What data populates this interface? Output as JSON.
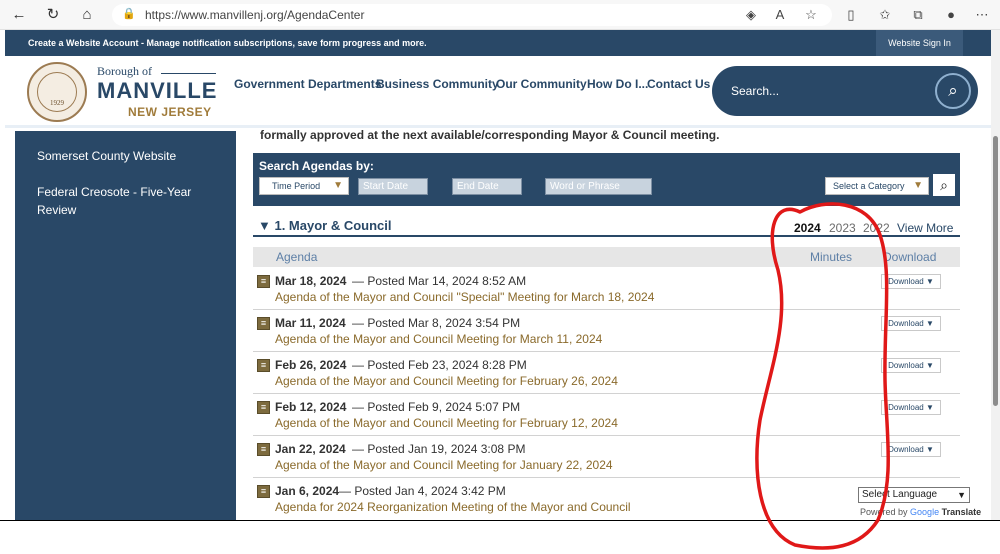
{
  "browser": {
    "url": "https://www.manvillenj.org/AgendaCenter"
  },
  "notice": {
    "text": "Create a Website Account - Manage notification subscriptions, save form progress and more.",
    "signin": "Website Sign In"
  },
  "brand": {
    "borough": "Borough of",
    "town": "MANVILLE",
    "state": "NEW JERSEY",
    "seal_year": "1929"
  },
  "nav": [
    "Government Departments",
    "Business Community",
    "Our Community",
    "How Do I...",
    "Contact Us"
  ],
  "site_search": {
    "placeholder": "Search..."
  },
  "sidebar": {
    "items": [
      "Somerset County Website",
      "Federal Creosote - Five-Year Review"
    ]
  },
  "intro_text": "formally approved at the next available/corresponding Mayor & Council meeting.",
  "search_agendas": {
    "title": "Search Agendas by:",
    "time_period": "Time Period",
    "start_date": "Start Date",
    "end_date": "End Date",
    "word": "Word or Phrase",
    "category": "Select a Category"
  },
  "category": {
    "title": "▼ 1. Mayor & Council",
    "years": [
      "2024",
      "2023",
      "2022"
    ],
    "view_more": "View More"
  },
  "columns": {
    "agenda": "Agenda",
    "minutes": "Minutes",
    "download": "Download"
  },
  "rows": [
    {
      "date": "Mar 18, 2024",
      "posted": "— Posted Mar 14, 2024 8:52 AM",
      "title": "Agenda of the Mayor and Council \"Special\" Meeting for March 18, 2024",
      "download": "Download ▼"
    },
    {
      "date": "Mar 11, 2024",
      "posted": "— Posted Mar 8, 2024 3:54 PM",
      "title": "Agenda of the Mayor and Council Meeting for March 11, 2024",
      "download": "Download ▼"
    },
    {
      "date": "Feb 26, 2024",
      "posted": "— Posted Feb 23, 2024 8:28 PM",
      "title": "Agenda of the Mayor and Council Meeting for February 26, 2024",
      "download": "Download ▼"
    },
    {
      "date": "Feb 12, 2024",
      "posted": "— Posted Feb 9, 2024 5:07 PM",
      "title": "Agenda of the Mayor and Council Meeting for February 12, 2024",
      "download": "Download ▼"
    },
    {
      "date": "Jan 22, 2024",
      "posted": "— Posted Jan 19, 2024 3:08 PM",
      "title": "Agenda of the Mayor and Council Meeting for January 22, 2024",
      "download": "Download ▼"
    },
    {
      "date": "Jan 6, 2024",
      "posted": "— Posted Jan 4, 2024 3:42 PM",
      "title": "Agenda for 2024 Reorganization Meeting of the Mayor and Council",
      "download": ""
    }
  ],
  "translate": {
    "select": "Select Language",
    "powered_prefix": "Powered by",
    "google": "Google",
    "translate": "Translate"
  },
  "colors": {
    "navy": "#294867",
    "gold": "#a07b3a",
    "annotation": "#e01818"
  }
}
